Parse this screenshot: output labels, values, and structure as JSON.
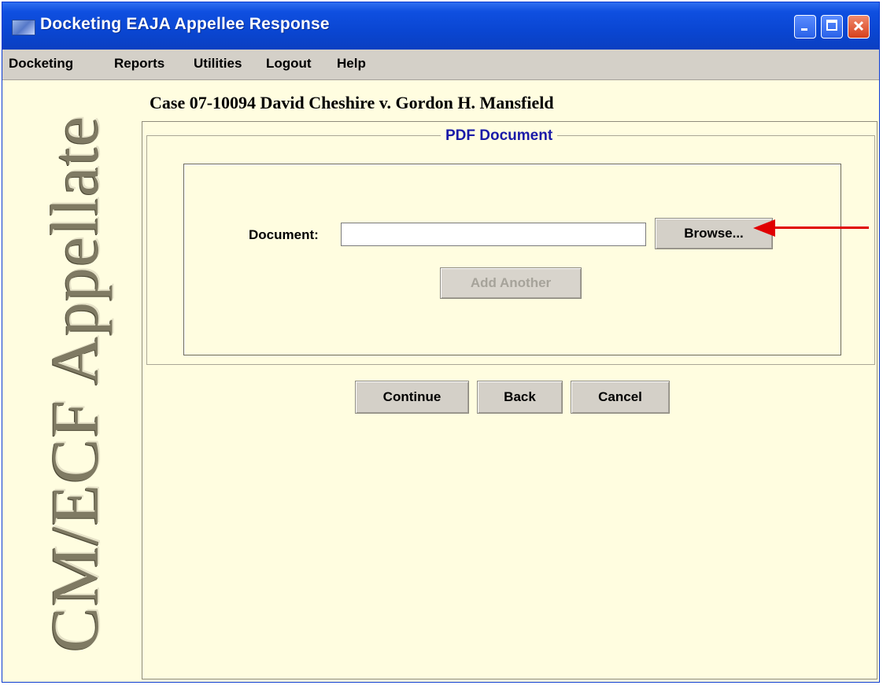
{
  "window": {
    "title": "Docketing EAJA Appellee Response"
  },
  "menu": {
    "items": [
      "Docketing",
      "Reports",
      "Utilities",
      "Logout",
      "Help"
    ]
  },
  "sidebar": {
    "logo_text": "CM/ECF Appellate"
  },
  "case": {
    "title": "Case 07-10094 David Cheshire v. Gordon H. Mansfield"
  },
  "pdf_section": {
    "legend": "PDF Document",
    "document_label": "Document:",
    "document_value": "",
    "browse_label": "Browse...",
    "add_another_label": "Add Another"
  },
  "actions": {
    "continue_label": "Continue",
    "back_label": "Back",
    "cancel_label": "Cancel"
  },
  "annotation": {
    "arrow_color": "#e00000",
    "points_to": "browse-button"
  },
  "colors": {
    "background": "#fffde0",
    "titlebar": "#0a46d2",
    "legend_text": "#1a1aa8"
  },
  "icons": {
    "min": "minimize-icon",
    "max": "maximize-icon",
    "close": "close-icon"
  }
}
